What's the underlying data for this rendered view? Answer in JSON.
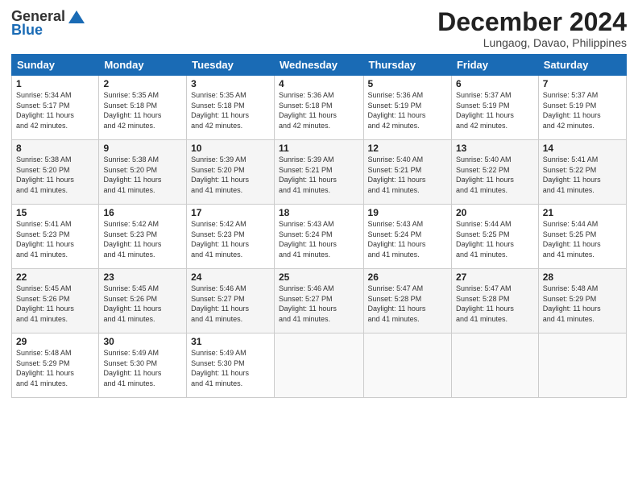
{
  "header": {
    "logo_general": "General",
    "logo_blue": "Blue",
    "month_title": "December 2024",
    "location": "Lungaog, Davao, Philippines"
  },
  "days_of_week": [
    "Sunday",
    "Monday",
    "Tuesday",
    "Wednesday",
    "Thursday",
    "Friday",
    "Saturday"
  ],
  "weeks": [
    [
      {
        "day": "1",
        "info": "Sunrise: 5:34 AM\nSunset: 5:17 PM\nDaylight: 11 hours\nand 42 minutes."
      },
      {
        "day": "2",
        "info": "Sunrise: 5:35 AM\nSunset: 5:18 PM\nDaylight: 11 hours\nand 42 minutes."
      },
      {
        "day": "3",
        "info": "Sunrise: 5:35 AM\nSunset: 5:18 PM\nDaylight: 11 hours\nand 42 minutes."
      },
      {
        "day": "4",
        "info": "Sunrise: 5:36 AM\nSunset: 5:18 PM\nDaylight: 11 hours\nand 42 minutes."
      },
      {
        "day": "5",
        "info": "Sunrise: 5:36 AM\nSunset: 5:19 PM\nDaylight: 11 hours\nand 42 minutes."
      },
      {
        "day": "6",
        "info": "Sunrise: 5:37 AM\nSunset: 5:19 PM\nDaylight: 11 hours\nand 42 minutes."
      },
      {
        "day": "7",
        "info": "Sunrise: 5:37 AM\nSunset: 5:19 PM\nDaylight: 11 hours\nand 42 minutes."
      }
    ],
    [
      {
        "day": "8",
        "info": "Sunrise: 5:38 AM\nSunset: 5:20 PM\nDaylight: 11 hours\nand 41 minutes."
      },
      {
        "day": "9",
        "info": "Sunrise: 5:38 AM\nSunset: 5:20 PM\nDaylight: 11 hours\nand 41 minutes."
      },
      {
        "day": "10",
        "info": "Sunrise: 5:39 AM\nSunset: 5:20 PM\nDaylight: 11 hours\nand 41 minutes."
      },
      {
        "day": "11",
        "info": "Sunrise: 5:39 AM\nSunset: 5:21 PM\nDaylight: 11 hours\nand 41 minutes."
      },
      {
        "day": "12",
        "info": "Sunrise: 5:40 AM\nSunset: 5:21 PM\nDaylight: 11 hours\nand 41 minutes."
      },
      {
        "day": "13",
        "info": "Sunrise: 5:40 AM\nSunset: 5:22 PM\nDaylight: 11 hours\nand 41 minutes."
      },
      {
        "day": "14",
        "info": "Sunrise: 5:41 AM\nSunset: 5:22 PM\nDaylight: 11 hours\nand 41 minutes."
      }
    ],
    [
      {
        "day": "15",
        "info": "Sunrise: 5:41 AM\nSunset: 5:23 PM\nDaylight: 11 hours\nand 41 minutes."
      },
      {
        "day": "16",
        "info": "Sunrise: 5:42 AM\nSunset: 5:23 PM\nDaylight: 11 hours\nand 41 minutes."
      },
      {
        "day": "17",
        "info": "Sunrise: 5:42 AM\nSunset: 5:23 PM\nDaylight: 11 hours\nand 41 minutes."
      },
      {
        "day": "18",
        "info": "Sunrise: 5:43 AM\nSunset: 5:24 PM\nDaylight: 11 hours\nand 41 minutes."
      },
      {
        "day": "19",
        "info": "Sunrise: 5:43 AM\nSunset: 5:24 PM\nDaylight: 11 hours\nand 41 minutes."
      },
      {
        "day": "20",
        "info": "Sunrise: 5:44 AM\nSunset: 5:25 PM\nDaylight: 11 hours\nand 41 minutes."
      },
      {
        "day": "21",
        "info": "Sunrise: 5:44 AM\nSunset: 5:25 PM\nDaylight: 11 hours\nand 41 minutes."
      }
    ],
    [
      {
        "day": "22",
        "info": "Sunrise: 5:45 AM\nSunset: 5:26 PM\nDaylight: 11 hours\nand 41 minutes."
      },
      {
        "day": "23",
        "info": "Sunrise: 5:45 AM\nSunset: 5:26 PM\nDaylight: 11 hours\nand 41 minutes."
      },
      {
        "day": "24",
        "info": "Sunrise: 5:46 AM\nSunset: 5:27 PM\nDaylight: 11 hours\nand 41 minutes."
      },
      {
        "day": "25",
        "info": "Sunrise: 5:46 AM\nSunset: 5:27 PM\nDaylight: 11 hours\nand 41 minutes."
      },
      {
        "day": "26",
        "info": "Sunrise: 5:47 AM\nSunset: 5:28 PM\nDaylight: 11 hours\nand 41 minutes."
      },
      {
        "day": "27",
        "info": "Sunrise: 5:47 AM\nSunset: 5:28 PM\nDaylight: 11 hours\nand 41 minutes."
      },
      {
        "day": "28",
        "info": "Sunrise: 5:48 AM\nSunset: 5:29 PM\nDaylight: 11 hours\nand 41 minutes."
      }
    ],
    [
      {
        "day": "29",
        "info": "Sunrise: 5:48 AM\nSunset: 5:29 PM\nDaylight: 11 hours\nand 41 minutes."
      },
      {
        "day": "30",
        "info": "Sunrise: 5:49 AM\nSunset: 5:30 PM\nDaylight: 11 hours\nand 41 minutes."
      },
      {
        "day": "31",
        "info": "Sunrise: 5:49 AM\nSunset: 5:30 PM\nDaylight: 11 hours\nand 41 minutes."
      },
      {
        "day": "",
        "info": ""
      },
      {
        "day": "",
        "info": ""
      },
      {
        "day": "",
        "info": ""
      },
      {
        "day": "",
        "info": ""
      }
    ]
  ]
}
